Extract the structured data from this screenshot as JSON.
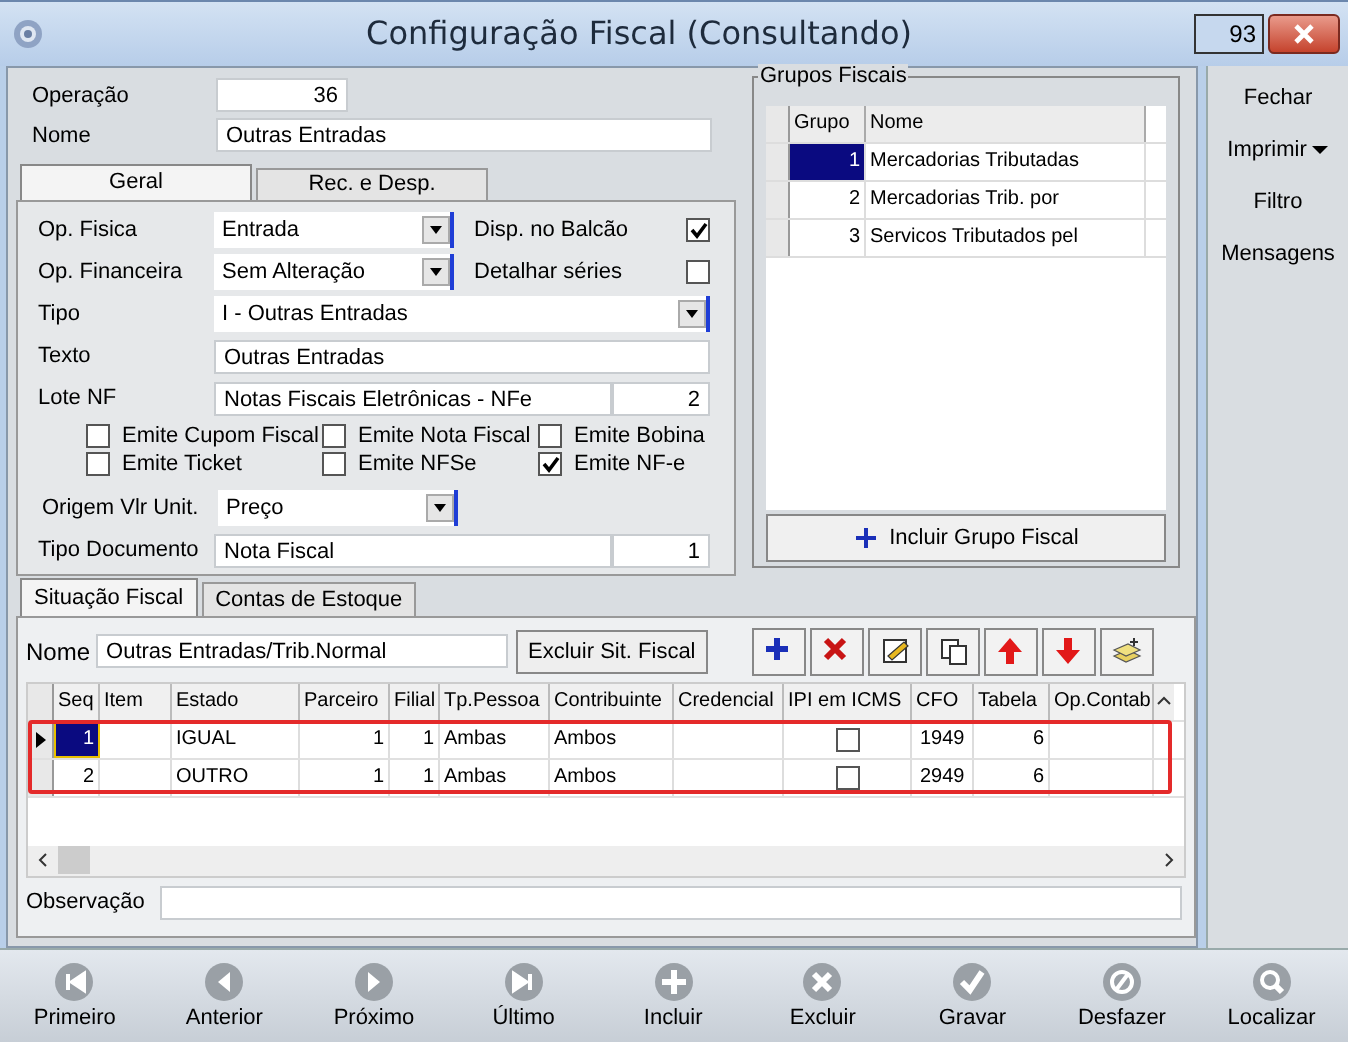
{
  "window": {
    "title": "Configuração Fiscal (Consultando)",
    "counter": "93"
  },
  "operacao": {
    "label": "Operação",
    "value": "36"
  },
  "nome": {
    "label": "Nome",
    "value": "Outras Entradas"
  },
  "upper_tabs": [
    {
      "label": "Geral",
      "selected": true
    },
    {
      "label": "Rec. e Desp.",
      "selected": false
    }
  ],
  "geral": {
    "op_fisica": {
      "label": "Op. Fisica",
      "value": "Entrada"
    },
    "op_financeira": {
      "label": "Op. Financeira",
      "value": "Sem Alteração"
    },
    "disp_balcao": {
      "label": "Disp. no Balcão",
      "checked": true
    },
    "detalhar_series": {
      "label": "Detalhar séries",
      "checked": false
    },
    "tipo": {
      "label": "Tipo",
      "value": "I - Outras Entradas"
    },
    "texto": {
      "label": "Texto",
      "value": "Outras Entradas"
    },
    "lote_nf": {
      "label": "Lote NF",
      "value": "Notas Fiscais Eletrônicas - NFe",
      "number": "2"
    },
    "emite_options": [
      {
        "label": "Emite Cupom Fiscal",
        "checked": false
      },
      {
        "label": "Emite Nota Fiscal",
        "checked": false
      },
      {
        "label": "Emite Bobina",
        "checked": false
      },
      {
        "label": "Emite Ticket",
        "checked": false
      },
      {
        "label": "Emite NFSe",
        "checked": false
      },
      {
        "label": "Emite NF-e",
        "checked": true
      }
    ],
    "origem_vlr_unit": {
      "label": "Origem Vlr Unit.",
      "value": "Preço"
    },
    "tipo_documento": {
      "label": "Tipo Documento",
      "value": "Nota Fiscal",
      "number": "1"
    }
  },
  "grupos_fiscais": {
    "title": "Grupos Fiscais",
    "columns": [
      "Grupo",
      "Nome"
    ],
    "rows": [
      {
        "grupo": "1",
        "nome": "Mercadorias Tributadas",
        "selected": true
      },
      {
        "grupo": "2",
        "nome": "Mercadorias Trib. por",
        "selected": false
      },
      {
        "grupo": "3",
        "nome": "Servicos Tributados pel",
        "selected": false
      }
    ],
    "button": "Incluir Grupo Fiscal"
  },
  "side_menu": [
    {
      "label": "Fechar",
      "dropdown": false
    },
    {
      "label": "Imprimir",
      "dropdown": true
    },
    {
      "label": "Filtro",
      "dropdown": false
    },
    {
      "label": "Mensagens",
      "dropdown": false
    }
  ],
  "lower_tabs": [
    {
      "label": "Situação Fiscal",
      "selected": true
    },
    {
      "label": "Contas de Estoque",
      "selected": false
    }
  ],
  "situacao": {
    "nome_label": "Nome",
    "nome_value": "Outras Entradas/Trib.Normal",
    "delete_button": "Excluir Sit. Fiscal",
    "tools": [
      {
        "kind": "add"
      },
      {
        "kind": "delete"
      },
      {
        "kind": "edit"
      },
      {
        "kind": "copy"
      },
      {
        "kind": "up"
      },
      {
        "kind": "down"
      },
      {
        "kind": "stack"
      }
    ],
    "grid": {
      "highlighted": true,
      "columns": [
        "Seq",
        "Item",
        "Estado",
        "Parceiro",
        "Filial",
        "Tp.Pessoa",
        "Contribuinte",
        "Credencial",
        "IPI em ICMS",
        "CFO",
        "Tabela",
        "Op.Contab"
      ],
      "rows": [
        {
          "seq": "1",
          "estado": "IGUAL",
          "parceiro": "1",
          "filial": "1",
          "tp_pessoa": "Ambas",
          "contribuinte": "Ambos",
          "ipi_em_icms": false,
          "cfo": "1949",
          "tabela": "6",
          "current": true
        },
        {
          "seq": "2",
          "estado": "OUTRO",
          "parceiro": "1",
          "filial": "1",
          "tp_pessoa": "Ambas",
          "contribuinte": "Ambos",
          "ipi_em_icms": false,
          "cfo": "2949",
          "tabela": "6",
          "current": false
        }
      ]
    },
    "observacao_label": "Observação"
  },
  "nav_buttons": [
    {
      "label": "Primeiro",
      "kind": "first"
    },
    {
      "label": "Anterior",
      "kind": "prev"
    },
    {
      "label": "Próximo",
      "kind": "next"
    },
    {
      "label": "Último",
      "kind": "last"
    },
    {
      "label": "Incluir",
      "kind": "add"
    },
    {
      "label": "Excluir",
      "kind": "delete"
    },
    {
      "label": "Gravar",
      "kind": "save"
    },
    {
      "label": "Desfazer",
      "kind": "undo"
    },
    {
      "label": "Localizar",
      "kind": "search"
    }
  ]
}
